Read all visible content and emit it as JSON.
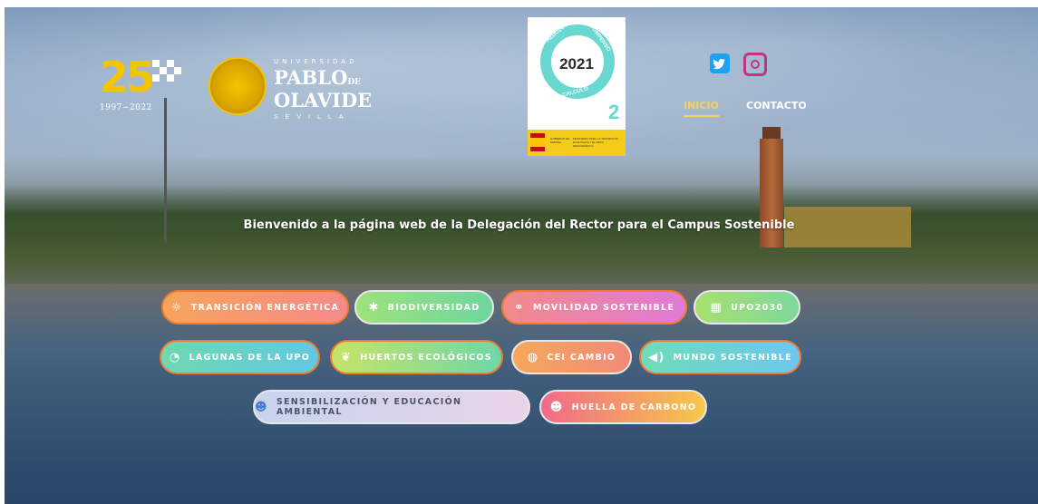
{
  "logos": {
    "anniversary_number": "25",
    "anniversary_years": "1997~2022",
    "university_top": "UNIVERSIDAD",
    "university_name_line1": "PABLO",
    "university_name_de": "DE",
    "university_name_line2": "OLAVIDE",
    "university_city": "SEVILLA"
  },
  "certificate": {
    "year": "2021",
    "words": [
      "REDUZCO",
      "COMPENSO",
      "CALCULO"
    ],
    "co2_subscript": "2",
    "gov_left": "GOBIERNO DE ESPAÑA",
    "gov_right": "MINISTERIO PARA LA TRANSICIÓN ECOLÓGICA Y EL RETO DEMOGRÁFICO"
  },
  "social": {
    "twitter_icon": "twitter-icon",
    "instagram_icon": "instagram-icon"
  },
  "nav": {
    "inicio": "INICIO",
    "contacto": "CONTACTO",
    "active": "INICIO"
  },
  "welcome": "Bienvenido a la página web de la Delegación del Rector para el Campus Sostenible",
  "buttons": [
    {
      "label": "TRANSICIÓN ENERGÉTICA",
      "icon": "sun-icon"
    },
    {
      "label": "BIODIVERSIDAD",
      "icon": "bug-icon"
    },
    {
      "label": "MOVILIDAD SOSTENIBLE",
      "icon": "bicycle-icon"
    },
    {
      "label": "UPO2030",
      "icon": "grid-icon"
    },
    {
      "label": "LAGUNAS DE LA UPO",
      "icon": "water-icon"
    },
    {
      "label": "HUERTOS ECOLÓGICOS",
      "icon": "seedling-icon"
    },
    {
      "label": "CEI CAMBIO",
      "icon": "globe-icon"
    },
    {
      "label": "MUNDO SOSTENIBLE",
      "icon": "speaker-icon"
    },
    {
      "label": "SENSIBILIZACIÓN Y EDUCACIÓN AMBIENTAL",
      "icon": "users-icon"
    },
    {
      "label": "HUELLA DE CARBONO",
      "icon": "users-icon"
    }
  ],
  "colors": {
    "accent": "#f7d25e",
    "button_border": "#f07a2e",
    "upo_yellow": "#f5c400",
    "cert_teal": "#69d8d0"
  }
}
